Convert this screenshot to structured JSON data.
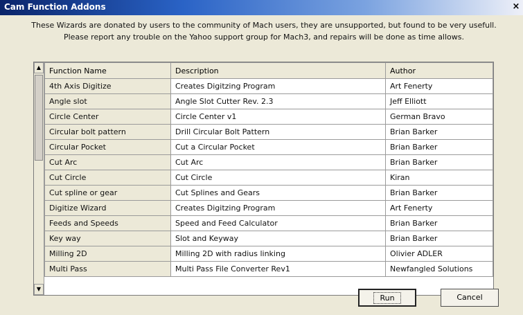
{
  "window": {
    "title": "Cam Function Addons"
  },
  "intro": {
    "line1": "These Wizards are donated by users to the community of Mach users, they are unsupported, but found to be very usefull.",
    "line2": "Please report any trouble on the Yahoo support group for Mach3, and repairs will be done as time allows."
  },
  "table": {
    "columns": [
      "Function Name",
      "Description",
      "Author"
    ],
    "rows": [
      [
        "4th Axis Digitize",
        "Creates Digitzing Program",
        "Art Fenerty"
      ],
      [
        "Angle slot",
        "Angle Slot Cutter  Rev. 2.3",
        "Jeff Elliott"
      ],
      [
        "Circle Center",
        "Circle Center v1",
        "German Bravo"
      ],
      [
        "Circular bolt pattern",
        "Drill Circular Bolt Pattern",
        "Brian Barker"
      ],
      [
        "Circular Pocket",
        "Cut a Circular Pocket",
        "Brian Barker"
      ],
      [
        "Cut Arc",
        "Cut Arc",
        "Brian Barker"
      ],
      [
        "Cut Circle",
        "Cut Circle",
        "Kiran"
      ],
      [
        "Cut spline or gear",
        "Cut Splines and Gears",
        "Brian Barker"
      ],
      [
        "Digitize Wizard",
        "Creates Digitzing Program",
        "Art Fenerty"
      ],
      [
        "Feeds and Speeds",
        "Speed and Feed Calculator",
        "Brian Barker"
      ],
      [
        "Key way",
        "Slot and Keyway",
        "Brian Barker"
      ],
      [
        "Milling 2D",
        "Milling 2D with radius linking",
        "Olivier ADLER"
      ],
      [
        "Multi Pass",
        "Multi Pass File Converter Rev1",
        "Newfangled Solutions"
      ]
    ]
  },
  "buttons": {
    "run": "Run",
    "cancel": "Cancel"
  },
  "icons": {
    "close": "close-icon",
    "scroll_up": "scroll-up-arrow-icon",
    "scroll_down": "scroll-down-arrow-icon"
  },
  "glyphs": {
    "close": "×",
    "up": "▲",
    "down": "▼"
  }
}
